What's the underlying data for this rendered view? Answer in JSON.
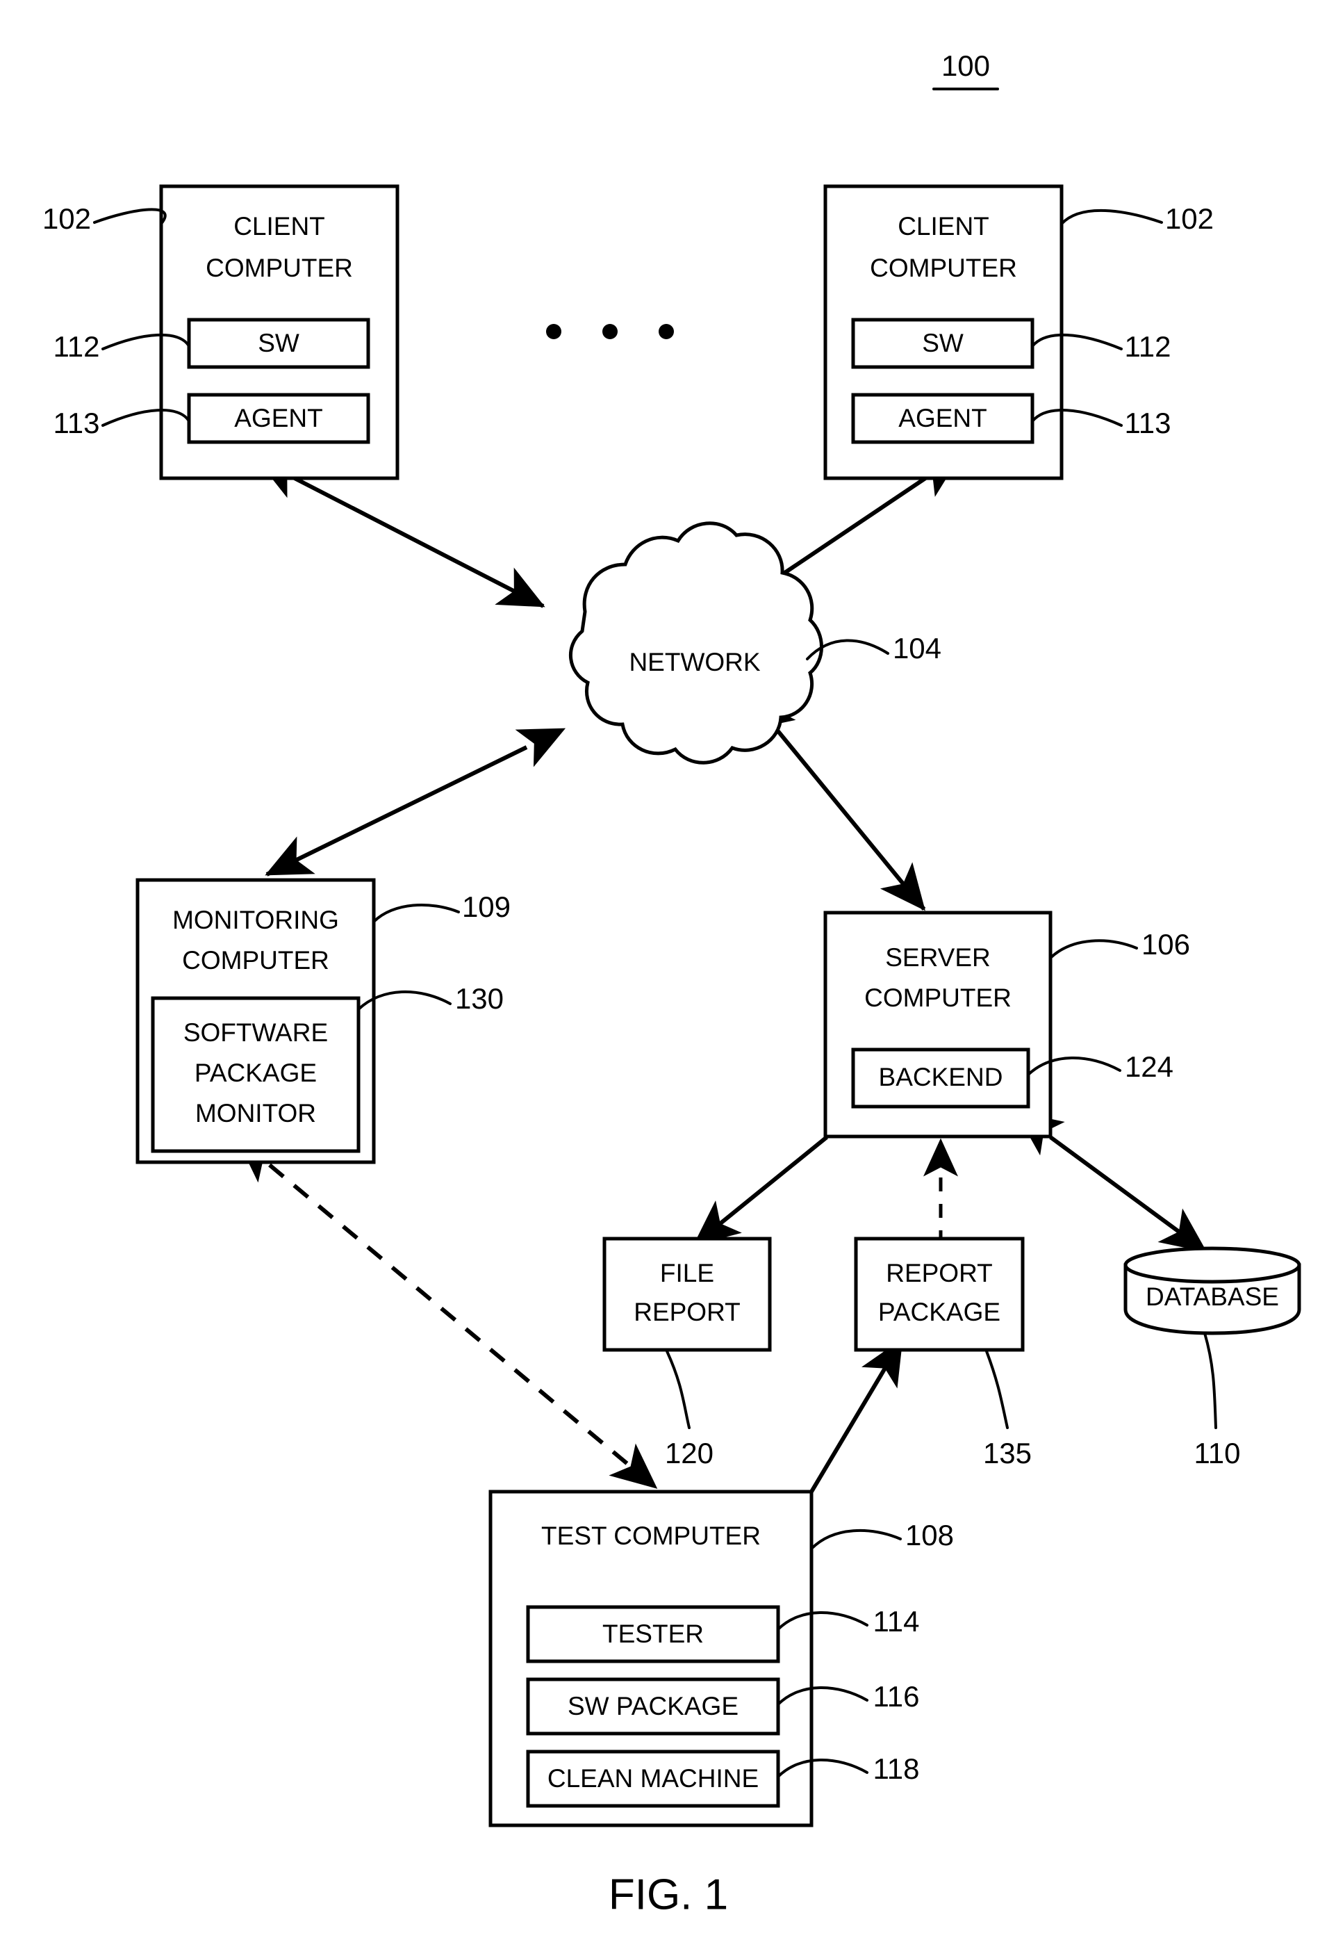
{
  "figure": {
    "caption": "FIG. 1",
    "system_label": "100"
  },
  "nodes": {
    "client_left": {
      "title_line1": "CLIENT",
      "title_line2": "COMPUTER",
      "ref": "102",
      "sub_boxes": [
        {
          "label": "SW",
          "ref": "112"
        },
        {
          "label": "AGENT",
          "ref": "113"
        }
      ]
    },
    "client_right": {
      "title_line1": "CLIENT",
      "title_line2": "COMPUTER",
      "ref": "102",
      "sub_boxes": [
        {
          "label": "SW",
          "ref": "112"
        },
        {
          "label": "AGENT",
          "ref": "113"
        }
      ]
    },
    "network": {
      "label": "NETWORK",
      "ref": "104"
    },
    "monitoring_computer": {
      "title_line1": "MONITORING",
      "title_line2": "COMPUTER",
      "ref": "109",
      "sub_boxes": [
        {
          "label_line1": "SOFTWARE",
          "label_line2": "PACKAGE",
          "label_line3": "MONITOR",
          "ref": "130"
        }
      ]
    },
    "server_computer": {
      "title_line1": "SERVER",
      "title_line2": "COMPUTER",
      "ref": "106",
      "sub_boxes": [
        {
          "label": "BACKEND",
          "ref": "124"
        }
      ]
    },
    "file_report": {
      "label_line1": "FILE",
      "label_line2": "REPORT",
      "ref": "120"
    },
    "report_package": {
      "label_line1": "REPORT",
      "label_line2": "PACKAGE",
      "ref": "135"
    },
    "database": {
      "label": "DATABASE",
      "ref": "110"
    },
    "test_computer": {
      "title": "TEST COMPUTER",
      "ref": "108",
      "sub_boxes": [
        {
          "label": "TESTER",
          "ref": "114"
        },
        {
          "label": "SW PACKAGE",
          "ref": "116"
        },
        {
          "label": "CLEAN MACHINE",
          "ref": "118"
        }
      ]
    }
  },
  "ellipsis": {
    "glyph": "•"
  },
  "colors": {
    "ink": "#000000",
    "paper": "#ffffff"
  }
}
